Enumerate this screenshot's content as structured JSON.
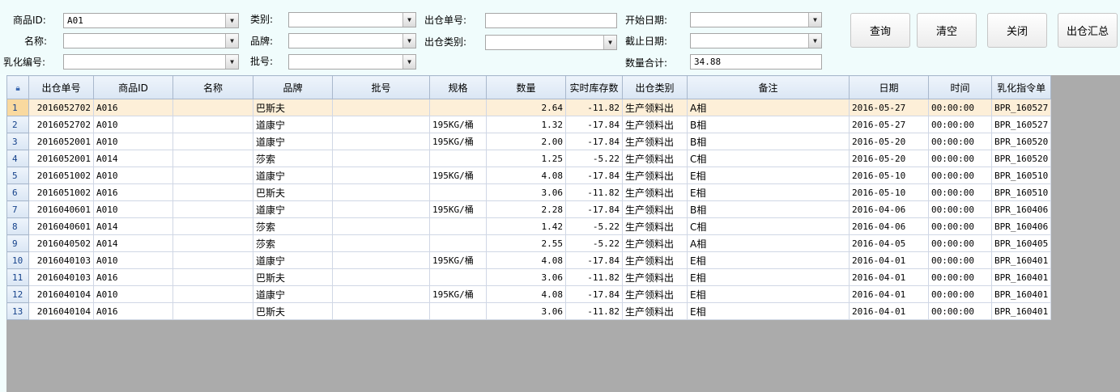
{
  "filters": {
    "product_id_label": "商品ID:",
    "product_id_value": "A01",
    "name_label": "名称:",
    "name_value": "",
    "emulsion_label": "乳化编号:",
    "emulsion_value": "",
    "category_label": "类别:",
    "category_value": "",
    "brand_label": "品牌:",
    "brand_value": "",
    "batch_label": "批号:",
    "batch_value": "",
    "out_no_label": "出仓单号:",
    "out_no_value": "",
    "out_type_label": "出仓类别:",
    "out_type_value": "",
    "start_date_label": "开始日期:",
    "start_date_value": "",
    "end_date_label": "截止日期:",
    "end_date_value": "",
    "qty_total_label": "数量合计:",
    "qty_total_value": "34.88"
  },
  "buttons": {
    "query": "查询",
    "clear": "清空",
    "close": "关闭",
    "summary": "出仓汇总"
  },
  "table": {
    "columns": [
      "出仓单号",
      "商品ID",
      "名称",
      "品牌",
      "批号",
      "规格",
      "数量",
      "实时库存数",
      "出仓类别",
      "备注",
      "日期",
      "时间",
      "乳化指令单"
    ],
    "rows": [
      [
        "2016052702",
        "A016",
        "",
        "巴斯夫",
        "",
        "",
        "2.64",
        "-11.82",
        "生产领料出",
        "A相",
        "2016-05-27",
        "00:00:00",
        "BPR_160527"
      ],
      [
        "2016052702",
        "A010",
        "",
        "道康宁",
        "",
        "195KG/桶",
        "1.32",
        "-17.84",
        "生产领料出",
        "B相",
        "2016-05-27",
        "00:00:00",
        "BPR_160527"
      ],
      [
        "2016052001",
        "A010",
        "",
        "道康宁",
        "",
        "195KG/桶",
        "2.00",
        "-17.84",
        "生产领料出",
        "B相",
        "2016-05-20",
        "00:00:00",
        "BPR_160520"
      ],
      [
        "2016052001",
        "A014",
        "",
        "莎索",
        "",
        "",
        "1.25",
        "-5.22",
        "生产领料出",
        "C相",
        "2016-05-20",
        "00:00:00",
        "BPR_160520"
      ],
      [
        "2016051002",
        "A010",
        "",
        "道康宁",
        "",
        "195KG/桶",
        "4.08",
        "-17.84",
        "生产领料出",
        "E相",
        "2016-05-10",
        "00:00:00",
        "BPR_160510"
      ],
      [
        "2016051002",
        "A016",
        "",
        "巴斯夫",
        "",
        "",
        "3.06",
        "-11.82",
        "生产领料出",
        "E相",
        "2016-05-10",
        "00:00:00",
        "BPR_160510"
      ],
      [
        "2016040601",
        "A010",
        "",
        "道康宁",
        "",
        "195KG/桶",
        "2.28",
        "-17.84",
        "生产领料出",
        "B相",
        "2016-04-06",
        "00:00:00",
        "BPR_160406"
      ],
      [
        "2016040601",
        "A014",
        "",
        "莎索",
        "",
        "",
        "1.42",
        "-5.22",
        "生产领料出",
        "C相",
        "2016-04-06",
        "00:00:00",
        "BPR_160406"
      ],
      [
        "2016040502",
        "A014",
        "",
        "莎索",
        "",
        "",
        "2.55",
        "-5.22",
        "生产领料出",
        "A相",
        "2016-04-05",
        "00:00:00",
        "BPR_160405"
      ],
      [
        "2016040103",
        "A010",
        "",
        "道康宁",
        "",
        "195KG/桶",
        "4.08",
        "-17.84",
        "生产领料出",
        "E相",
        "2016-04-01",
        "00:00:00",
        "BPR_160401"
      ],
      [
        "2016040103",
        "A016",
        "",
        "巴斯夫",
        "",
        "",
        "3.06",
        "-11.82",
        "生产领料出",
        "E相",
        "2016-04-01",
        "00:00:00",
        "BPR_160401"
      ],
      [
        "2016040104",
        "A010",
        "",
        "道康宁",
        "",
        "195KG/桶",
        "4.08",
        "-17.84",
        "生产领料出",
        "E相",
        "2016-04-01",
        "00:00:00",
        "BPR_160401"
      ],
      [
        "2016040104",
        "A016",
        "",
        "巴斯夫",
        "",
        "",
        "3.06",
        "-11.82",
        "生产领料出",
        "E相",
        "2016-04-01",
        "00:00:00",
        "BPR_160401"
      ]
    ],
    "selected_row": 1,
    "corner_icon": "lock-icon"
  }
}
